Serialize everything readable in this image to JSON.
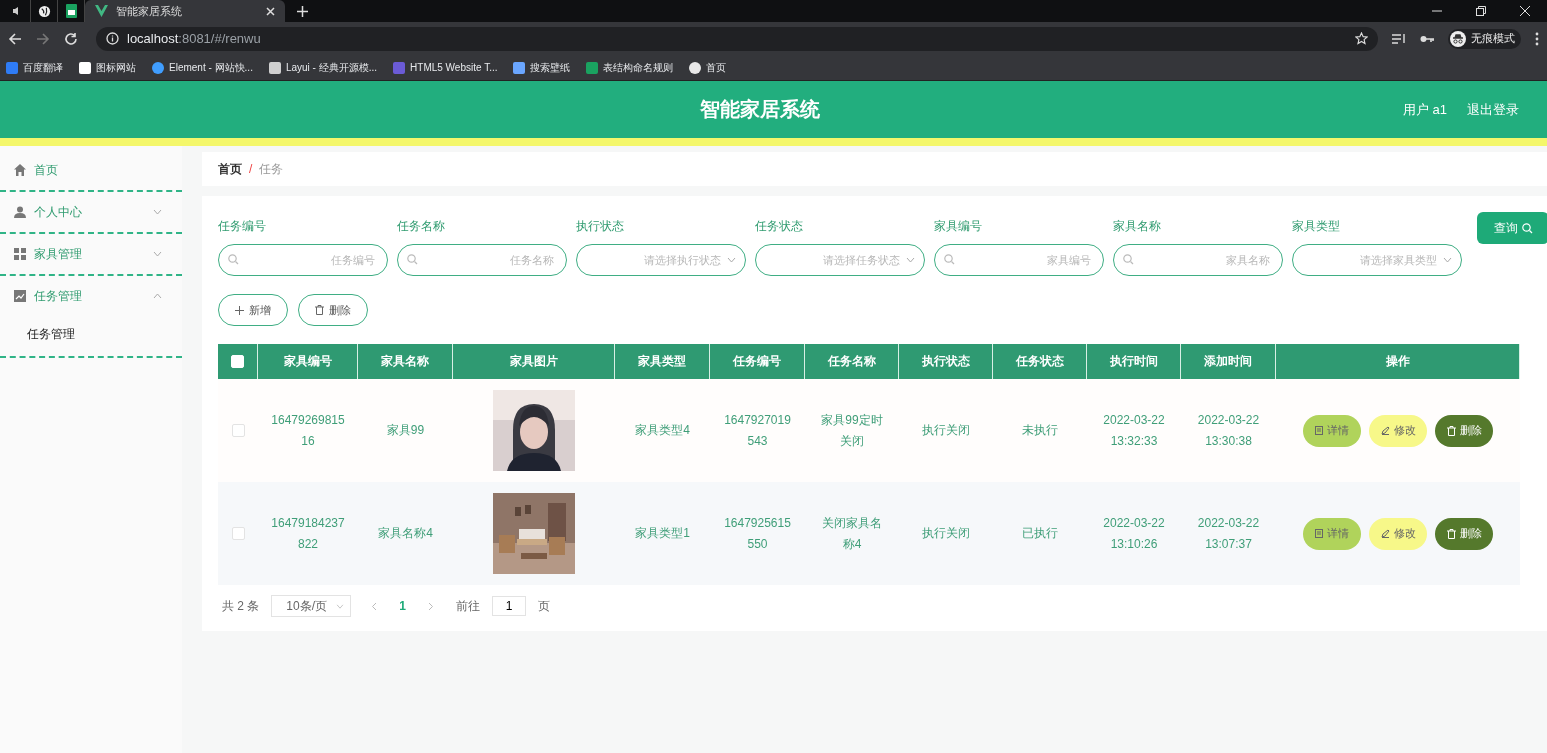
{
  "browser": {
    "tabs": [
      {
        "kind": "audio",
        "selected": false
      },
      {
        "kind": "globe",
        "selected": false
      },
      {
        "kind": "sheet",
        "selected": false
      },
      {
        "kind": "page",
        "title": "智能家居系统",
        "selected": true
      }
    ],
    "url_host": "localhost",
    "url_rest": ":8081/#/renwu",
    "profile_label": "无痕模式",
    "bookmarks": [
      {
        "kind": "translate",
        "label": "百度翻译"
      },
      {
        "kind": "flag",
        "label": "图标网站"
      },
      {
        "kind": "element",
        "label": "Element - 网站快..."
      },
      {
        "kind": "layui",
        "label": "Layui - 经典开源模..."
      },
      {
        "kind": "html5",
        "label": "HTML5 Website T..."
      },
      {
        "kind": "u",
        "label": "搜索壁纸"
      },
      {
        "kind": "sheet",
        "label": "表结构命名规则"
      },
      {
        "kind": "globe",
        "label": "首页"
      }
    ]
  },
  "app": {
    "title": "智能家居系统",
    "user": "用户 a1",
    "logout": "退出登录"
  },
  "sidebar": {
    "items": [
      {
        "kind": "home",
        "label": "首页"
      },
      {
        "kind": "user",
        "label": "个人中心",
        "expanded": false
      },
      {
        "kind": "grid",
        "label": "家具管理",
        "expanded": false
      },
      {
        "kind": "chart",
        "label": "任务管理",
        "expanded": true,
        "children": [
          {
            "label": "任务管理"
          }
        ]
      }
    ]
  },
  "breadcrumb": [
    "首页",
    "任务"
  ],
  "breadcrumb_separator": "/",
  "filters": [
    {
      "kind": "input",
      "label": "任务编号",
      "placeholder": "任务编号"
    },
    {
      "kind": "input",
      "label": "任务名称",
      "placeholder": "任务名称"
    },
    {
      "kind": "select",
      "label": "执行状态",
      "placeholder": "请选择执行状态"
    },
    {
      "kind": "select",
      "label": "任务状态",
      "placeholder": "请选择任务状态"
    },
    {
      "kind": "input",
      "label": "家具编号",
      "placeholder": "家具编号"
    },
    {
      "kind": "input",
      "label": "家具名称",
      "placeholder": "家具名称"
    },
    {
      "kind": "select",
      "label": "家具类型",
      "placeholder": "请选择家具类型"
    }
  ],
  "search_button": "查询",
  "actions": [
    {
      "kind": "add",
      "label": "新增"
    },
    {
      "kind": "delete",
      "label": "删除"
    }
  ],
  "table": {
    "select_all_checked": false,
    "columns": [
      "家具编号",
      "家具名称",
      "家具图片",
      "家具类型",
      "任务编号",
      "任务名称",
      "执行状态",
      "任务状态",
      "执行时间",
      "添加时间",
      "操作"
    ],
    "rows": [
      {
        "checked": false,
        "cells": [
          "1647926981516",
          "家具99",
          {
            "kind": "picture"
          },
          "家具类型4",
          "1647927019543",
          "家具99定时关闭",
          "执行关闭",
          "未执行",
          "2022-03-22 13:32:33",
          "2022-03-22 13:30:38"
        ],
        "buttons": [
          {
            "kind": "detail",
            "label": "详情"
          },
          {
            "kind": "edit",
            "label": "修改"
          },
          {
            "kind": "delete",
            "label": "删除"
          }
        ]
      },
      {
        "checked": false,
        "cells": [
          "16479184237822",
          "家具名称4",
          {
            "kind": "picture"
          },
          "家具类型1",
          "1647925615550",
          "关闭家具名称4",
          "执行关闭",
          "已执行",
          "2022-03-22 13:10:26",
          "2022-03-22 13:07:37"
        ],
        "buttons": [
          {
            "kind": "detail",
            "label": "详情"
          },
          {
            "kind": "edit",
            "label": "修改"
          },
          {
            "kind": "delete",
            "label": "删除"
          }
        ]
      }
    ]
  },
  "pagination": {
    "total": "共 2 条",
    "page_size": "10条/页",
    "pages": [
      {
        "label": "1",
        "selected": true
      }
    ],
    "goto_label": "前往",
    "goto_value": "1",
    "page_suffix": "页"
  }
}
